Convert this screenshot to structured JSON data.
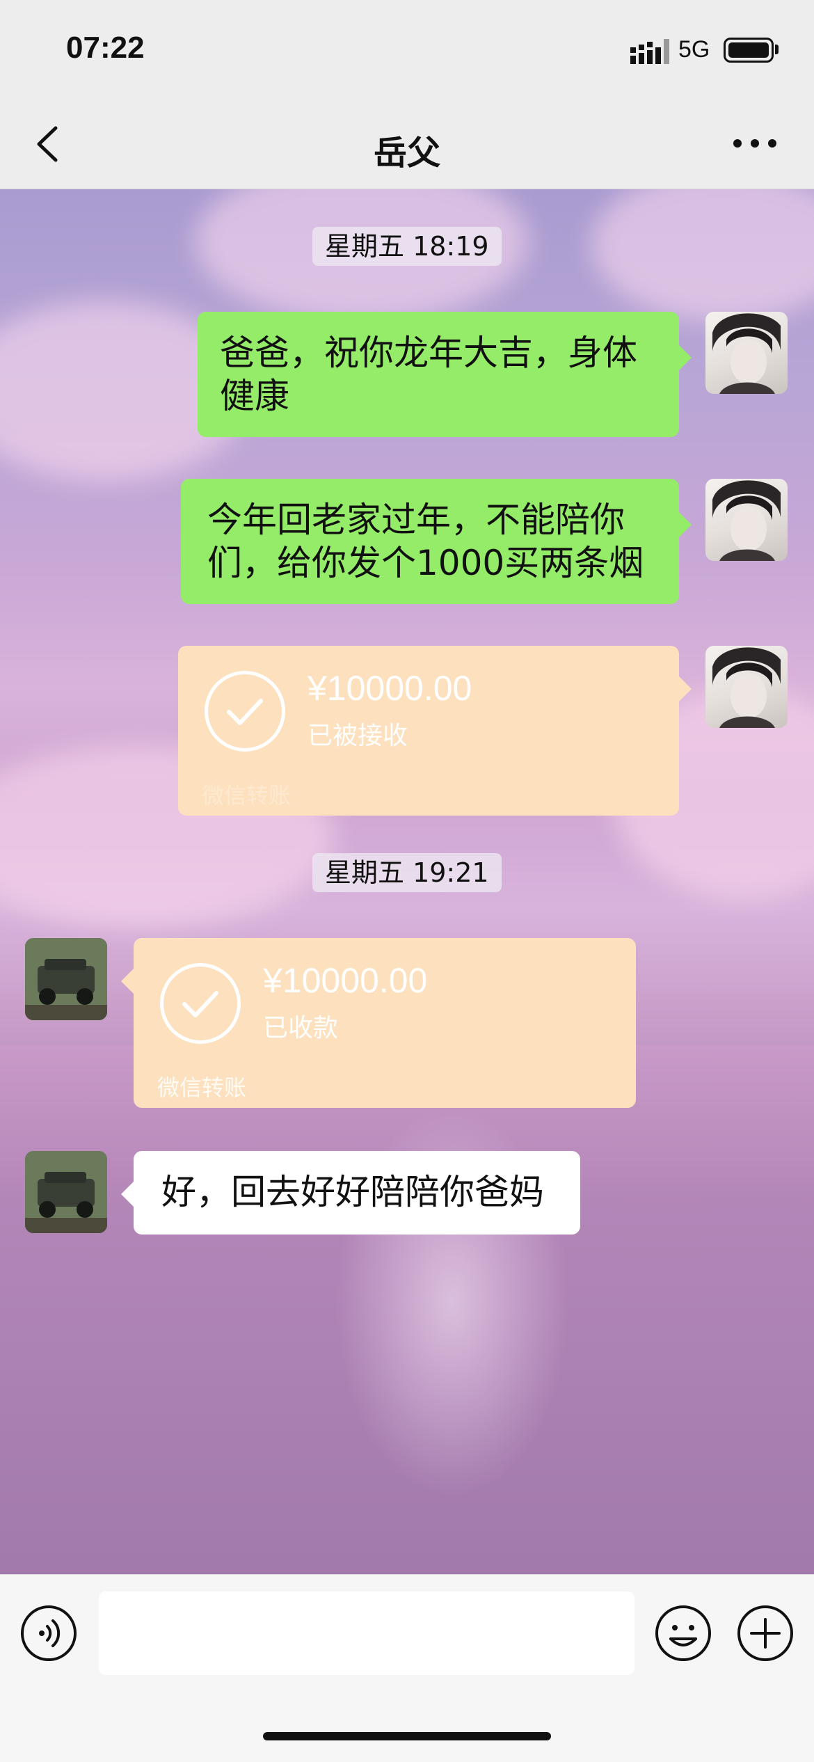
{
  "status_bar": {
    "time": "07:22",
    "network": "5G"
  },
  "nav": {
    "title": "岳父"
  },
  "messages": {
    "ts1": "星期五 18:19",
    "msg1": "爸爸，祝你龙年大吉，身体健康",
    "msg2": "今年回老家过年，不能陪你们，给你发个1000买两条烟",
    "transfer1": {
      "amount": "¥10000.00",
      "status": "已被接收",
      "footer": "微信转账"
    },
    "ts2": "星期五 19:21",
    "transfer2": {
      "amount": "¥10000.00",
      "status": "已收款",
      "footer": "微信转账"
    },
    "msg3": "好，回去好好陪陪你爸妈"
  },
  "colors": {
    "sent_bubble": "#95ec69",
    "transfer_bubble": "#fde0be",
    "received_bubble": "#ffffff"
  },
  "icons": {
    "back": "chevron-left-icon",
    "more": "more-dots-icon",
    "voice": "voice-icon",
    "emoji": "emoji-icon",
    "plus": "plus-icon"
  }
}
